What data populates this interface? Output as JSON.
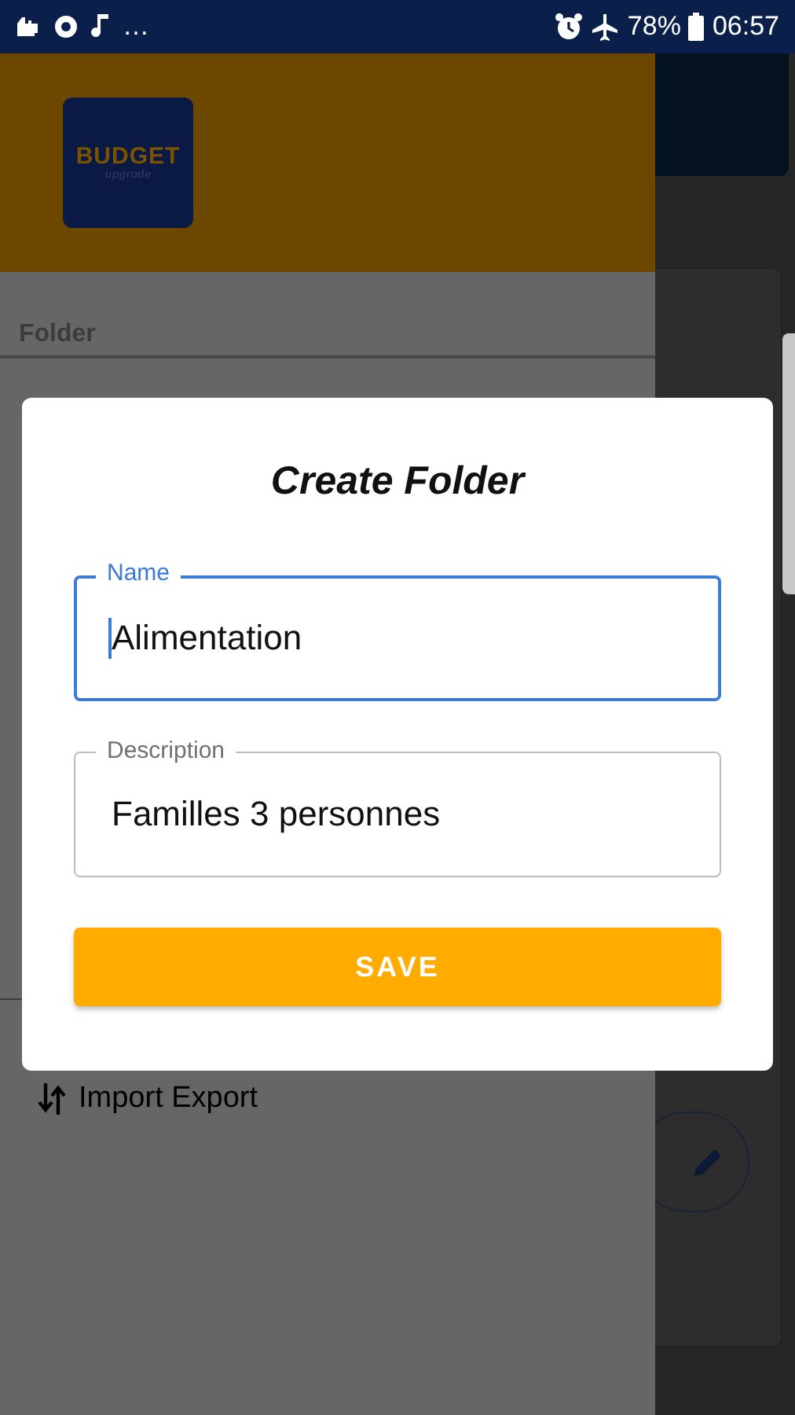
{
  "status_bar": {
    "overflow": "…",
    "battery": "78%",
    "time": "06:57"
  },
  "app_logo": {
    "title": "BUDGET",
    "subtitle": "upgrade"
  },
  "drawer": {
    "section_label": "Folder",
    "items": [
      {
        "label": "Import Export"
      }
    ]
  },
  "dialog": {
    "title": "Create Folder",
    "fields": [
      {
        "label": "Name",
        "value": "Alimentation",
        "focused": true
      },
      {
        "label": "Description",
        "value": "Familles 3 personnes",
        "focused": false
      }
    ],
    "button": "SAVE"
  }
}
